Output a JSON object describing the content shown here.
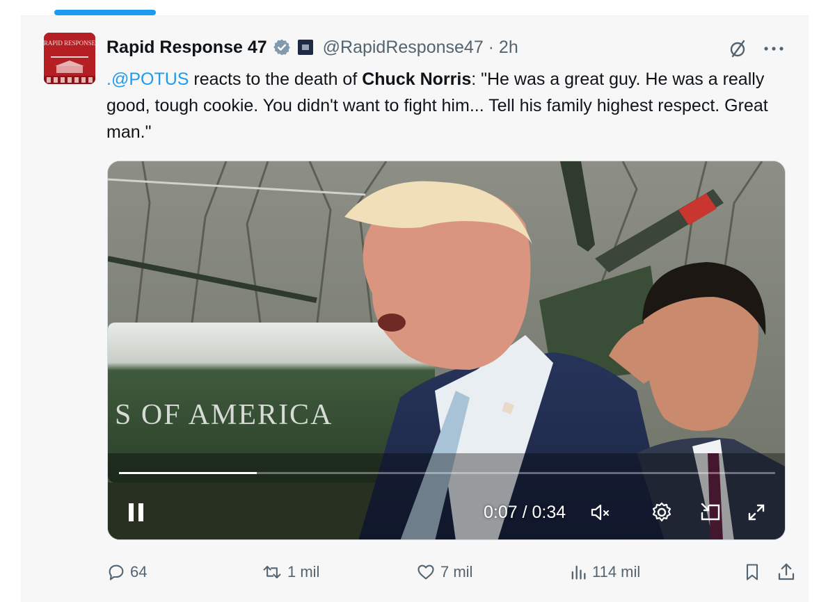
{
  "tweet": {
    "display_name": "Rapid Response 47",
    "handle": "@RapidResponse47 · 2h",
    "avatar_text": "RAPID RESPONSE",
    "text": {
      "mention": ".@POTUS",
      "part1": " reacts to the death of ",
      "bold": "Chuck Norris",
      "part2": ": \"He was a great guy. He was a really good, tough cookie. You didn't want to fight him... Tell his family highest respect. Great man.\""
    },
    "video": {
      "time": "0:07 / 0:34",
      "progress": 0.21,
      "overlay_text": "S OF AMERICA"
    },
    "actions": {
      "replies": "64",
      "reposts": "1 mil",
      "likes": "7 mil",
      "views": "114 mil"
    }
  },
  "icons": {
    "verified": "verified-badge-icon",
    "affiliate": "affiliate-badge-icon",
    "grok": "grok-icon",
    "more": "more-icon",
    "reply": "reply-icon",
    "repost": "repost-icon",
    "like": "like-icon",
    "views": "views-icon",
    "bookmark": "bookmark-icon",
    "share": "share-icon",
    "pause": "pause-icon",
    "mute": "mute-icon",
    "settings": "settings-icon",
    "pip": "picture-in-picture-icon",
    "fullscreen": "fullscreen-icon"
  },
  "colors": {
    "accent": "#1d9bf0",
    "avatar_bg": "#b51f23",
    "muted_text": "#536471"
  }
}
